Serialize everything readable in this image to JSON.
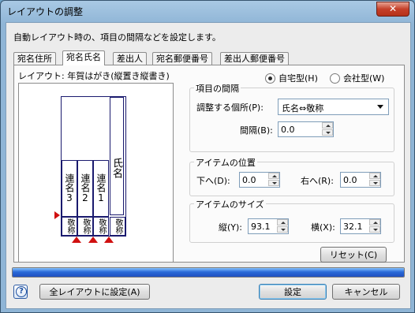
{
  "window": {
    "title": "レイアウトの調整",
    "close_glyph": "✕"
  },
  "description": "自動レイアウト時の、項目の間隔などを設定します。",
  "tabs": [
    {
      "label": "宛名住所",
      "active": false
    },
    {
      "label": "宛名氏名",
      "active": true
    },
    {
      "label": "差出人",
      "active": false
    },
    {
      "label": "宛名郵便番号",
      "active": false
    },
    {
      "label": "差出人郵便番号",
      "active": false
    }
  ],
  "layout_label": "レイアウト: 年賀はがき(縦置き縦書き)",
  "preview": {
    "name_text": "氏名",
    "renmei": [
      "連名3",
      "連名2",
      "連名1"
    ],
    "keisho": [
      "敬称",
      "敬称",
      "敬称",
      "敬称"
    ]
  },
  "type_options": [
    {
      "label": "自宅型(H)",
      "selected": true
    },
    {
      "label": "会社型(W)",
      "selected": false
    }
  ],
  "spacing_group": {
    "title": "項目の間隔",
    "adjust_label": "調整する個所(P):",
    "adjust_value": "氏名⇔敬称",
    "gap_label": "間隔(B):",
    "gap_value": "0.0"
  },
  "position_group": {
    "title": "アイテムの位置",
    "down_label": "下へ(D):",
    "down_value": "0.0",
    "right_label": "右へ(R):",
    "right_value": "0.0"
  },
  "size_group": {
    "title": "アイテムのサイズ",
    "height_label": "縦(Y):",
    "height_value": "93.1",
    "width_label": "横(X):",
    "width_value": "32.1"
  },
  "reset_button": "リセット(C)",
  "progress_fraction": 1.0,
  "footer": {
    "apply_all_button": "全レイアウトに設定(A)",
    "ok_button": "設定",
    "cancel_button": "キャンセル"
  },
  "colors": {
    "accent_red": "#d01010",
    "progress_blue": "#2a6ad8"
  }
}
